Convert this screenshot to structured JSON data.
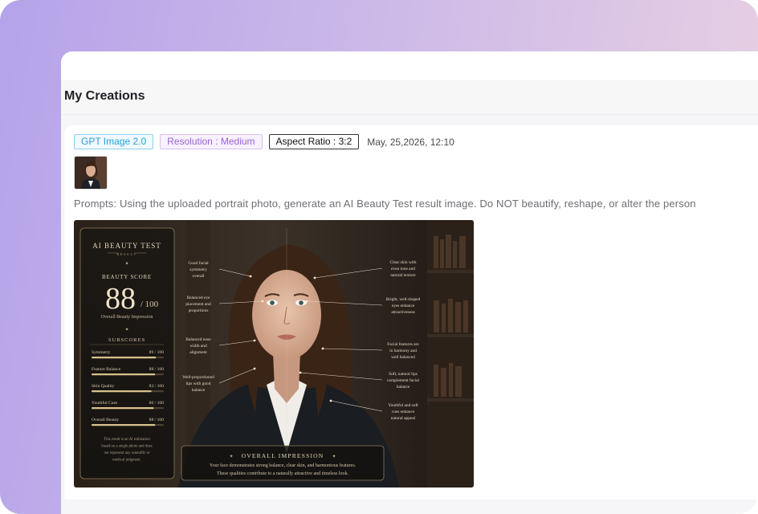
{
  "page": {
    "title": "My Creations"
  },
  "creation": {
    "model": "GPT Image 2.0",
    "resolution": "Resolution : Medium",
    "aspect_ratio": "Aspect Ratio : 3:2",
    "date": "May, 25,2026, 12:10",
    "prompt": "Prompts: Using the uploaded portrait photo, generate an AI Beauty Test result image. Do NOT beautify, reshape, or alter the person"
  },
  "result_image": {
    "card_title": "AI BEAUTY TEST",
    "card_subtitle": "RESULT",
    "score_label": "BEAUTY SCORE",
    "score": "88",
    "score_max": "/ 100",
    "score_caption": "Overall Beauty Impression",
    "subscores_title": "SUBSCORES",
    "subscores": [
      {
        "label": "Symmetry",
        "value": "89 / 100",
        "pct": 0.89
      },
      {
        "label": "Feature Balance",
        "value": "88 / 100",
        "pct": 0.88
      },
      {
        "label": "Skin Quality",
        "value": "83 / 100",
        "pct": 0.83
      },
      {
        "label": "Youthful Cues",
        "value": "86 / 100",
        "pct": 0.86
      },
      {
        "label": "Overall Beauty",
        "value": "88 / 100",
        "pct": 0.88
      }
    ],
    "disclaimer": [
      "This result is an AI estimation",
      "based on a single photo and does",
      "not represent any scientific or",
      "medical judgment."
    ],
    "annotations_left": [
      [
        "Good facial",
        "symmetry",
        "overall"
      ],
      [
        "Balanced eye",
        "placement and",
        "proportions"
      ],
      [
        "Balanced nose",
        "width and",
        "alignment"
      ],
      [
        "Well-proportioned",
        "lips with good",
        "balance"
      ]
    ],
    "annotations_right": [
      [
        "Clear skin with",
        "even tone and",
        "natural texture"
      ],
      [
        "Bright, well-shaped",
        "eyes enhance",
        "attractiveness"
      ],
      [
        "Facial features are",
        "in harmony and",
        "well balanced"
      ],
      [
        "Soft, natural lips",
        "complement facial",
        "balance"
      ],
      [
        "Youthful and soft",
        "cues enhance",
        "natural appeal"
      ]
    ],
    "overall_title": "OVERALL IMPRESSION",
    "overall_text": [
      "Your face demonstrates strong balance, clear skin, and harmonious features.",
      "These qualities contribute to a naturally attractive and timeless look."
    ]
  }
}
